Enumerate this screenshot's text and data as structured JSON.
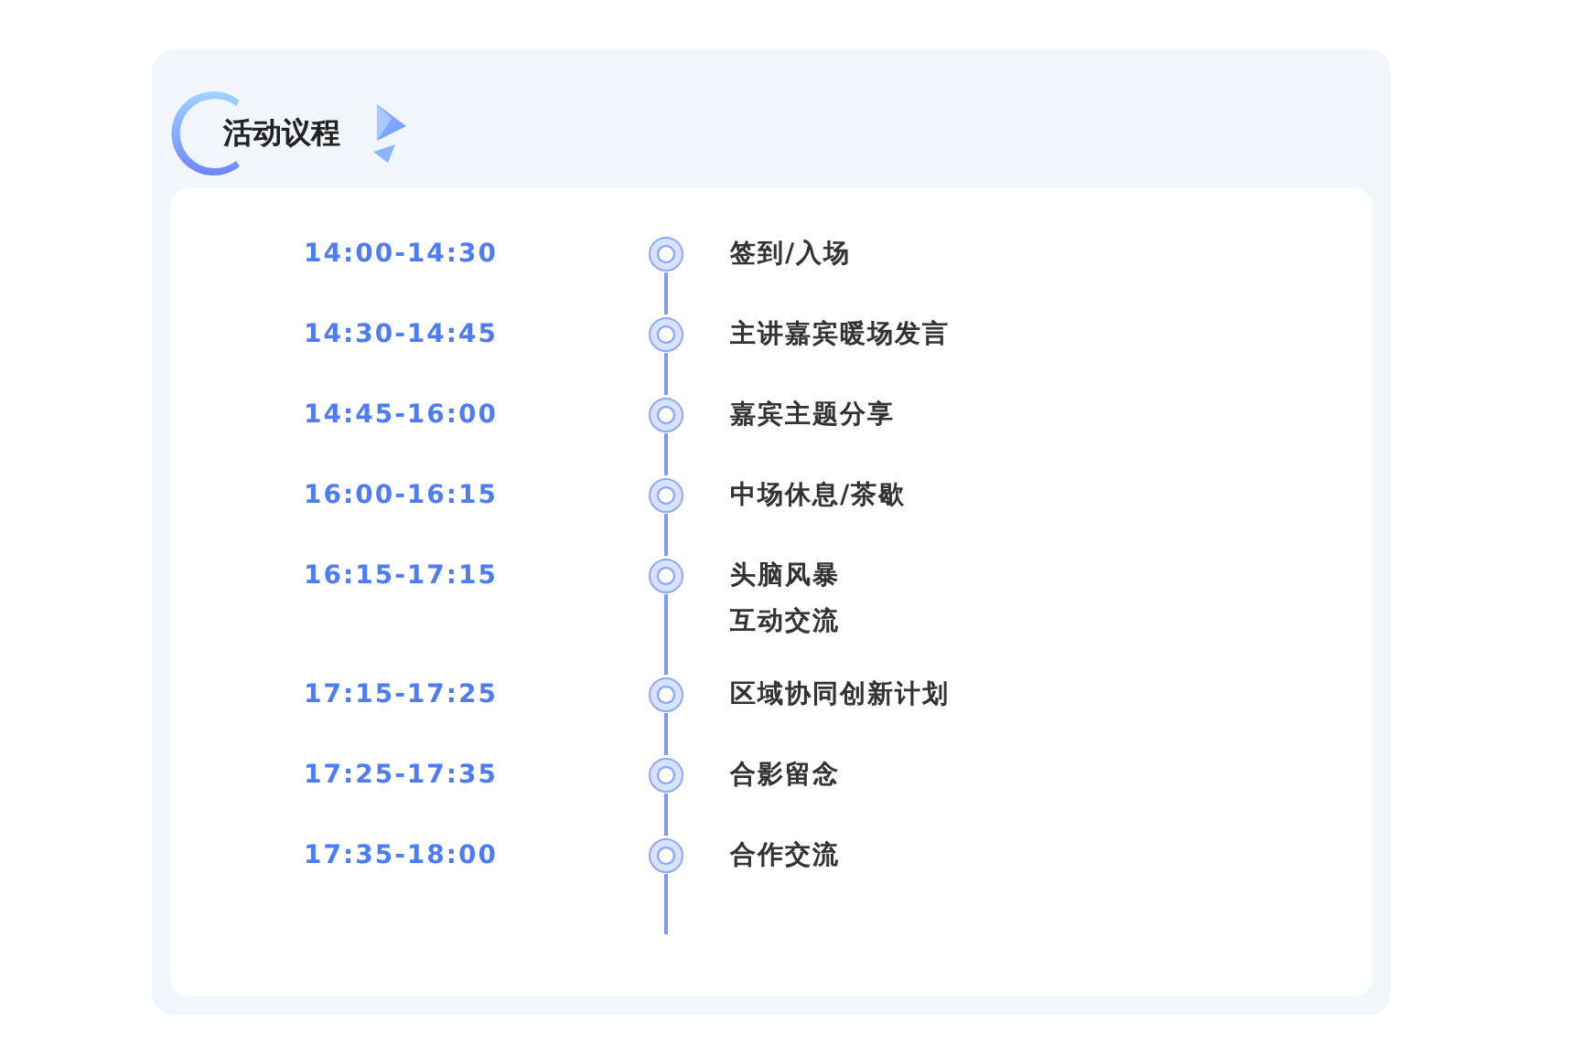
{
  "title": "活动议程",
  "agenda": [
    {
      "time": "14:00-14:30",
      "lines": [
        "签到/入场"
      ]
    },
    {
      "time": "14:30-14:45",
      "lines": [
        "主讲嘉宾暖场发言"
      ]
    },
    {
      "time": "14:45-16:00",
      "lines": [
        "嘉宾主题分享"
      ]
    },
    {
      "time": "16:00-16:15",
      "lines": [
        "中场休息/茶歇"
      ]
    },
    {
      "time": "16:15-17:15",
      "lines": [
        "头脑风暴",
        "互动交流"
      ]
    },
    {
      "time": "17:15-17:25",
      "lines": [
        "区域协同创新计划"
      ]
    },
    {
      "time": "17:25-17:35",
      "lines": [
        "合影留念"
      ]
    },
    {
      "time": "17:35-18:00",
      "lines": [
        "合作交流"
      ]
    }
  ]
}
